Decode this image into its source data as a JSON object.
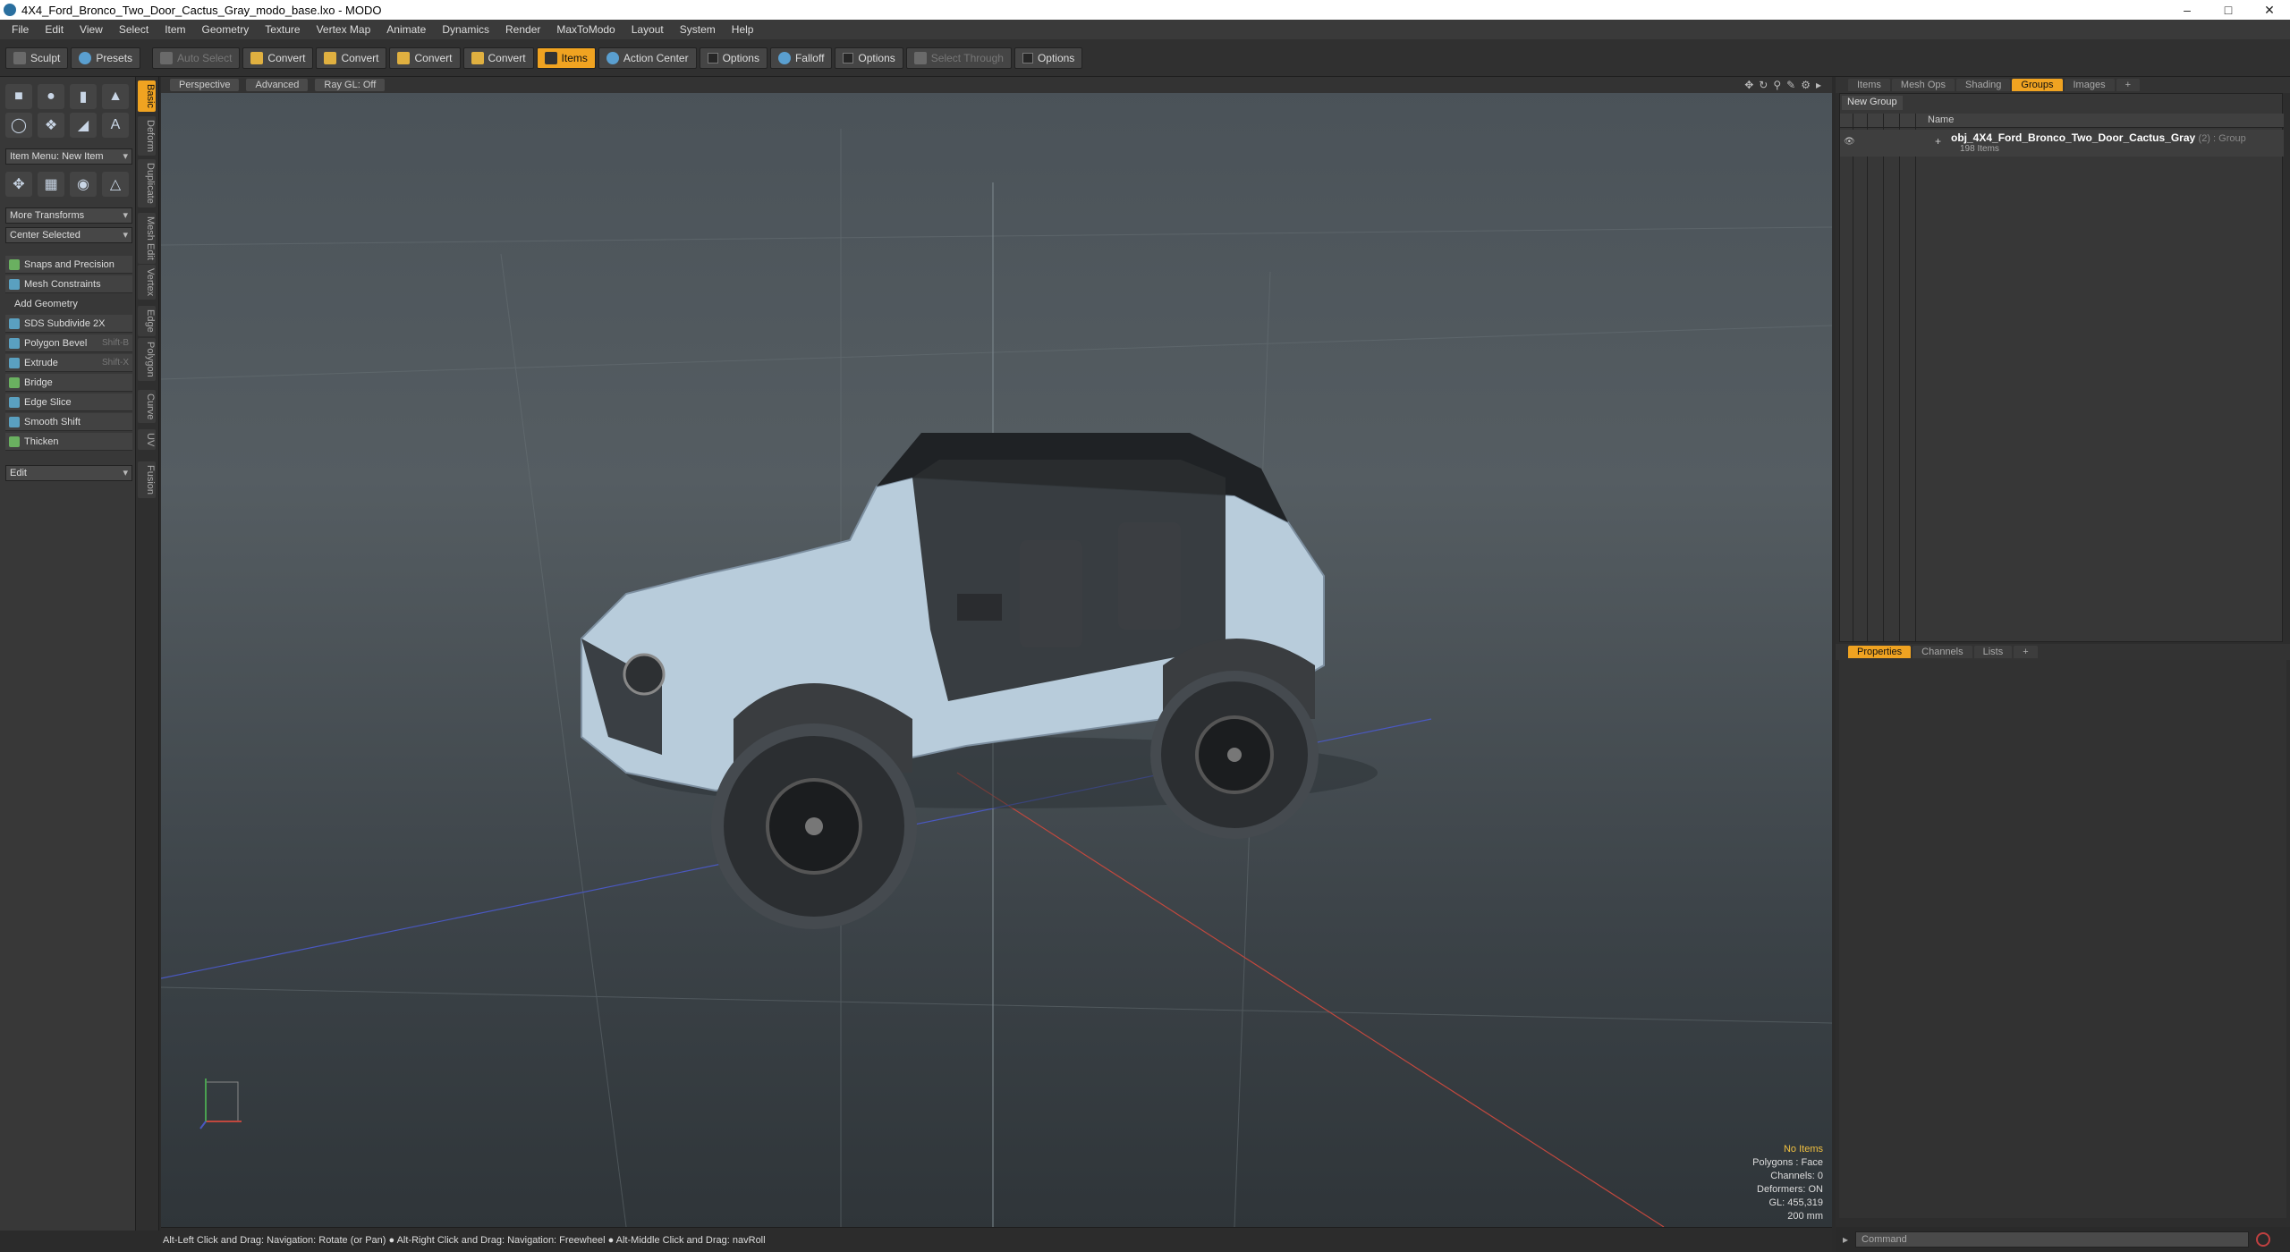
{
  "window": {
    "title": "4X4_Ford_Bronco_Two_Door_Cactus_Gray_modo_base.lxo - MODO"
  },
  "menu": [
    "File",
    "Edit",
    "View",
    "Select",
    "Item",
    "Geometry",
    "Texture",
    "Vertex Map",
    "Animate",
    "Dynamics",
    "Render",
    "MaxToModo",
    "Layout",
    "System",
    "Help"
  ],
  "toolbar": {
    "sculpt": "Sculpt",
    "presets": "Presets",
    "auto_select": "Auto Select",
    "convert": "Convert",
    "items": "Items",
    "action_center": "Action Center",
    "options": "Options",
    "falloff": "Falloff",
    "select_through": "Select Through"
  },
  "left": {
    "item_menu": "Item Menu: New Item",
    "more_transforms": "More Transforms",
    "center_selected": "Center Selected",
    "snaps": "Snaps and Precision",
    "mesh_constraints": "Mesh Constraints",
    "add_geometry": "Add Geometry",
    "tools": [
      {
        "label": "SDS Subdivide 2X",
        "shortcut": ""
      },
      {
        "label": "Polygon Bevel",
        "shortcut": "Shift-B"
      },
      {
        "label": "Extrude",
        "shortcut": "Shift-X"
      },
      {
        "label": "Bridge",
        "shortcut": ""
      },
      {
        "label": "Edge Slice",
        "shortcut": ""
      },
      {
        "label": "Smooth Shift",
        "shortcut": ""
      },
      {
        "label": "Thicken",
        "shortcut": ""
      }
    ],
    "edit": "Edit",
    "vtabs": [
      "Basic",
      "Deform",
      "Duplicate",
      "Mesh Edit",
      "Vertex",
      "Edge",
      "Polygon",
      "Curve",
      "UV",
      "Fusion"
    ]
  },
  "viewport": {
    "perspective": "Perspective",
    "advanced": "Advanced",
    "raygl": "Ray GL: Off",
    "info": {
      "selection": "No Items",
      "polygons": "Polygons : Face",
      "channels": "Channels: 0",
      "deformers": "Deformers: ON",
      "gl": "GL: 455,319",
      "scale": "200 mm"
    }
  },
  "status": "Alt-Left Click and Drag: Navigation: Rotate (or Pan) ● Alt-Right Click and Drag: Navigation: Freewheel ● Alt-Middle Click and Drag: navRoll",
  "right": {
    "tabs": [
      "Items",
      "Mesh Ops",
      "Shading",
      "Groups",
      "Images",
      "+"
    ],
    "new_group": "New Group",
    "col_name": "Name",
    "group_name": "obj_4X4_Ford_Bronco_Two_Door_Cactus_Gray",
    "group_suffix": "(2) : Group",
    "group_count": "198 Items",
    "props_tabs": [
      "Properties",
      "Channels",
      "Lists",
      "+"
    ],
    "command_placeholder": "Command"
  },
  "colors": {
    "accent": "#f0a321",
    "body": "#b8ccdb"
  }
}
